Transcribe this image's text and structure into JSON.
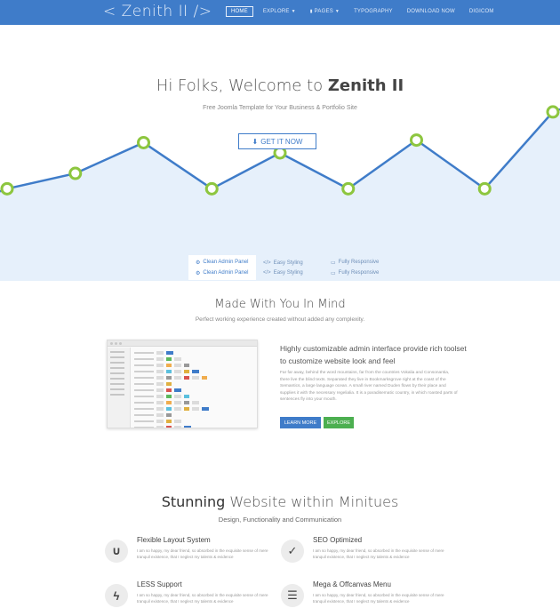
{
  "header": {
    "logo": "< Zenith II />",
    "nav": [
      {
        "label": "HOME",
        "active": true
      },
      {
        "label": "EXPLORE",
        "caret": true
      },
      {
        "label": "PAGES",
        "caret": true
      },
      {
        "label": "TYPOGRAPHY"
      },
      {
        "label": "DOWNLOAD NOW"
      },
      {
        "label": "DIGICOM"
      }
    ],
    "bg_color": "#3f7cc9"
  },
  "hero": {
    "title_prefix": "Hi Folks, Welcome to ",
    "title_bold": "Zenith II",
    "subtitle": "Free Joomla Template for Your Business & Portfolio Site",
    "cta_label": "GET IT NOW",
    "cta_icon": "download-icon",
    "graph_points": [
      0.36,
      0.42,
      0.54,
      0.36,
      0.5,
      0.36,
      0.55,
      0.36,
      0.66
    ],
    "line_color": "#3f7cc9",
    "marker_color": "#8dc63f",
    "fill_color": "#e6f0fb"
  },
  "tabs": [
    {
      "label": "Clean Admin Panel",
      "icon": "gears-icon",
      "active": true
    },
    {
      "label": "Easy Styling",
      "icon": "code-icon"
    },
    {
      "label": "Fully Responsive",
      "icon": "monitor-icon"
    }
  ],
  "section2": {
    "title": "Made With You In Mind",
    "subtitle": "Perfect working experience created without added any complexity.",
    "heading": "Highly customizable admin interface provide rich toolset to customize website look and feel",
    "body": "Far far away, behind the word mountains, far from the countries Vokalia and Consonantia, there live the blind texts. Separated they live in Bookmarksgrove right at the coast of the Semantics, a large language ocean. A small river named Duden flows by their place and supplies it with the necessary regelialia. It is a paradisematic country, in which roasted parts of sentences fly into your mouth.",
    "learn_more": "LEARN MORE",
    "explore": "EXPLORE"
  },
  "section3": {
    "title_bold": "Stunning",
    "title_rest": " Website within Minitues",
    "subtitle": "Design, Functionality and Communication",
    "features": [
      {
        "title": "Flexible Layout System",
        "icon": "magnet-icon",
        "glyph": "∪",
        "desc": "I am so happy, my dear friend, so absorbed in the exquisite sense of mere tranquil existence, that I neglect my talents & evidence"
      },
      {
        "title": "SEO Optimized",
        "icon": "check-icon",
        "glyph": "✓",
        "desc": "I am so happy, my dear friend, so absorbed in the exquisite sense of mere tranquil existence, that I neglect my talents & evidence"
      },
      {
        "title": "LESS Support",
        "icon": "bolt-icon",
        "glyph": "ϟ",
        "desc": "I am so happy, my dear friend, so absorbed in the exquisite sense of mere tranquil existence, that I neglect my talents & evidence"
      },
      {
        "title": "Mega & Offcanvas Menu",
        "icon": "menu-icon",
        "glyph": "☰",
        "desc": "I am so happy, my dear friend, so absorbed in the exquisite sense of mere tranquil existence, that I neglect my talents & evidence"
      }
    ]
  }
}
